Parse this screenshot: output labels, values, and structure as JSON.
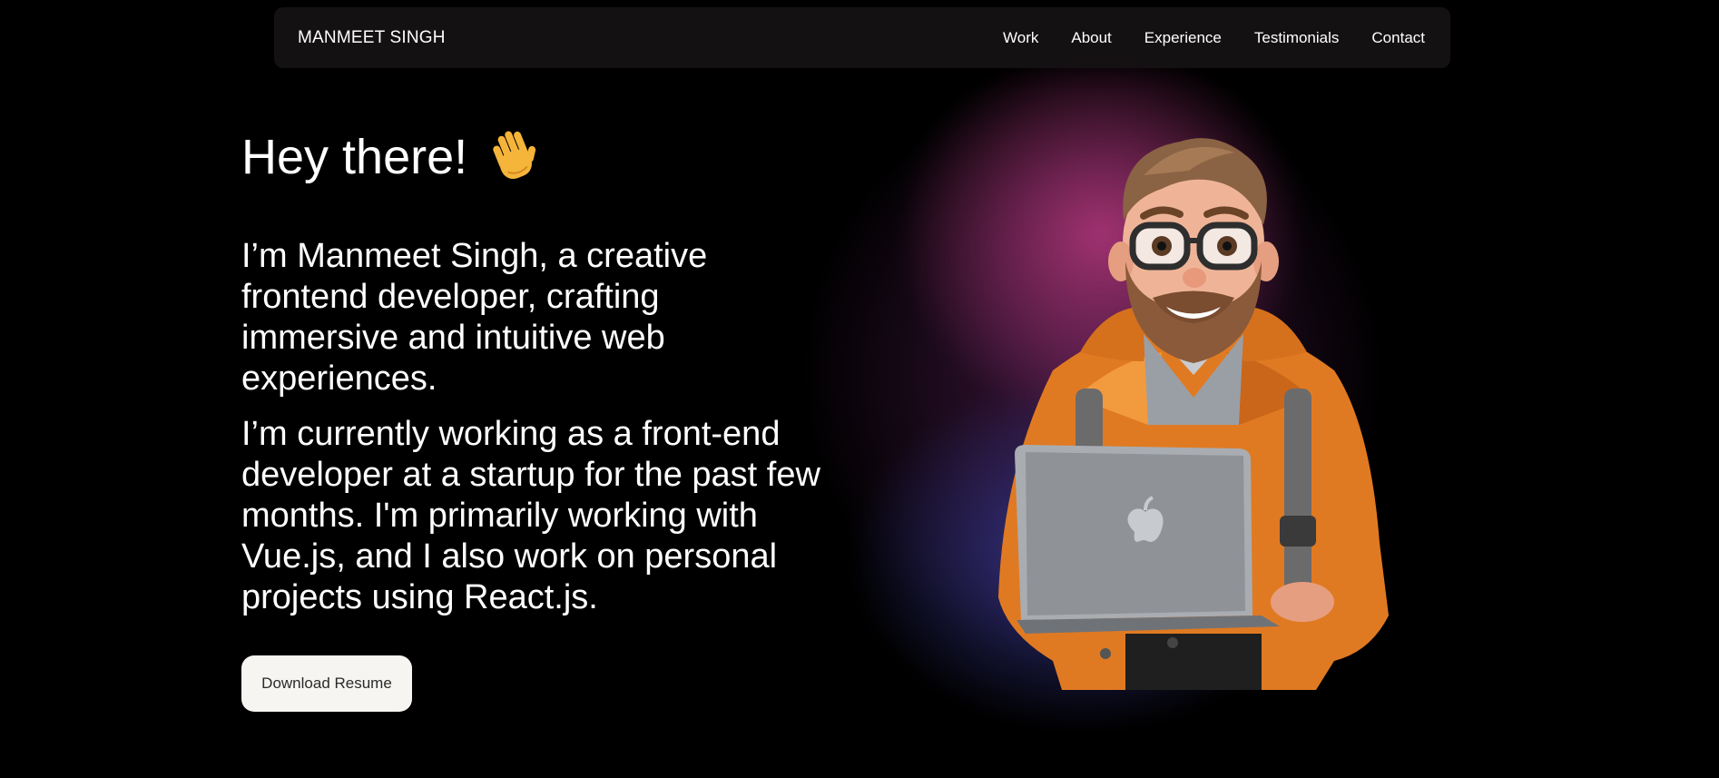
{
  "nav": {
    "logo": "MANMEET SINGH",
    "links": [
      "Work",
      "About",
      "Experience",
      "Testimonials",
      "Contact"
    ]
  },
  "hero": {
    "greeting": "Hey there!",
    "wave_icon": "waving-hand-icon",
    "intro": "I’m Manmeet Singh, a creative frontend developer, crafting immersive and intuitive web experiences.",
    "current": "I’m currently working as a front-end developer at a startup for the past few months. I'm primarily working with Vue.js, and I also work on personal projects using React.js.",
    "button_label": "Download Resume"
  },
  "avatar": {
    "icon": "developer-avatar-illustration"
  },
  "colors": {
    "background": "#000000",
    "glow_magenta": "#a83476",
    "glow_blue": "#3a3a98",
    "jacket_orange": "#e07a22",
    "button_bg": "#f7f5f2"
  }
}
